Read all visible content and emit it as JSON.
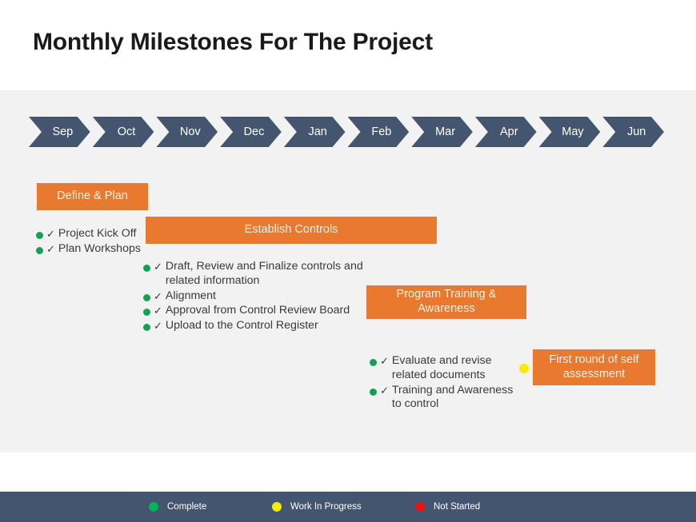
{
  "title": "Monthly Milestones For The Project",
  "timeline": {
    "months": [
      {
        "label": "Sep"
      },
      {
        "label": "Oct"
      },
      {
        "label": "Nov"
      },
      {
        "label": "Dec"
      },
      {
        "label": "Jan"
      },
      {
        "label": "Feb"
      },
      {
        "label": "Mar"
      },
      {
        "label": "Apr"
      },
      {
        "label": "May"
      },
      {
        "label": "Jun"
      }
    ]
  },
  "phases": [
    {
      "id": "define-plan",
      "label": "Define & Plan"
    },
    {
      "id": "establish-controls",
      "label": "Establish Controls"
    },
    {
      "id": "program-training",
      "label": "Program  Training & Awareness"
    },
    {
      "id": "self-assessment",
      "label": "First round of self assessment"
    }
  ],
  "milestone_groups": [
    {
      "id": "define-plan",
      "items": [
        {
          "status": "complete",
          "check": "✓",
          "text": "Project Kick Off"
        },
        {
          "status": "complete",
          "check": "✓",
          "text": "Plan Workshops"
        }
      ]
    },
    {
      "id": "establish",
      "items": [
        {
          "status": "complete",
          "check": "✓",
          "text": "Draft, Review and Finalize controls and related information"
        },
        {
          "status": "complete",
          "check": "✓",
          "text": "Alignment"
        },
        {
          "status": "complete",
          "check": "✓",
          "text": "Approval from  Control Review Board"
        },
        {
          "status": "complete",
          "check": "✓",
          "text": "Upload to the Control Register"
        }
      ]
    },
    {
      "id": "training",
      "items": [
        {
          "status": "complete",
          "check": "✓",
          "text": "Evaluate and revise related documents"
        },
        {
          "status": "complete",
          "check": "✓",
          "text": "Training and Awareness to control"
        }
      ]
    }
  ],
  "self_assessment_status": "in-progress",
  "legend": {
    "items": [
      {
        "id": "complete",
        "label": "Complete",
        "color": "#00b451"
      },
      {
        "id": "in-progress",
        "label": "Work In Progress",
        "color": "#f5ec00"
      },
      {
        "id": "not-started",
        "label": "Not Started",
        "color": "#ee1111"
      }
    ]
  },
  "colors": {
    "chevron": "#43556f",
    "phase_bar": "#e8792e",
    "panel_bg": "#f2f2f2",
    "footer_bg": "#43556f",
    "complete": "#13a254",
    "in_progress": "#f5ec00",
    "not_started": "#ee2222"
  }
}
